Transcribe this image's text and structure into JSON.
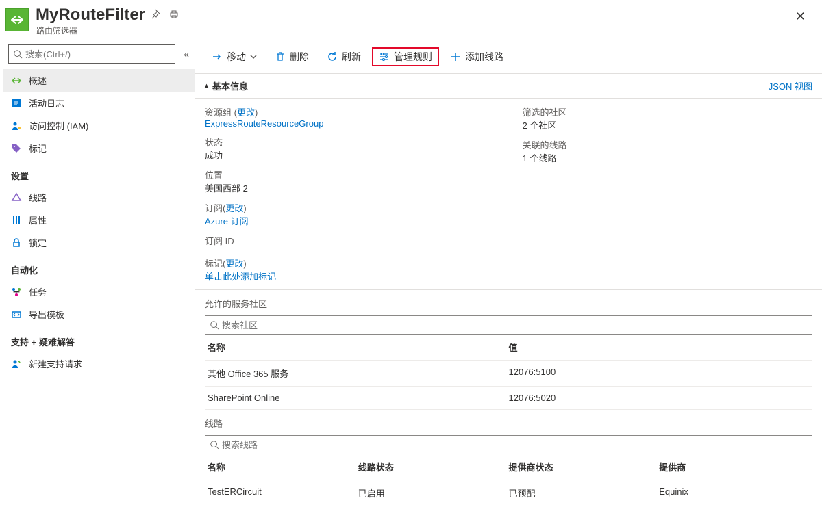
{
  "header": {
    "title": "MyRouteFilter",
    "subtitle": "路由筛选器"
  },
  "search": {
    "placeholder": "搜索(Ctrl+/)"
  },
  "nav": {
    "main": [
      {
        "label": "概述",
        "active": true
      },
      {
        "label": "活动日志"
      },
      {
        "label": "访问控制 (IAM)"
      },
      {
        "label": "标记"
      }
    ],
    "groups": [
      {
        "title": "设置",
        "items": [
          {
            "label": "线路"
          },
          {
            "label": "属性"
          },
          {
            "label": "锁定"
          }
        ]
      },
      {
        "title": "自动化",
        "items": [
          {
            "label": "任务"
          },
          {
            "label": "导出模板"
          }
        ]
      },
      {
        "title": "支持 + 疑难解答",
        "items": [
          {
            "label": "新建支持请求"
          }
        ]
      }
    ]
  },
  "toolbar": {
    "move": "移动",
    "delete": "删除",
    "refresh": "刷新",
    "manage": "管理规则",
    "add": "添加线路"
  },
  "section": {
    "title": "基本信息",
    "json_view": "JSON 视图"
  },
  "props": {
    "left": [
      {
        "label": "资源组",
        "change": "更改",
        "linkval": "ExpressRouteResourceGroup"
      },
      {
        "label": "状态",
        "val": "成功"
      },
      {
        "label": "位置",
        "val": "美国西部 2"
      },
      {
        "label": "订阅",
        "change": "更改",
        "linkval": "Azure 订阅"
      },
      {
        "label": "订阅 ID",
        "val": ""
      }
    ],
    "right": [
      {
        "label": "筛选的社区",
        "val": "2 个社区"
      },
      {
        "label": "关联的线路",
        "val": "1 个线路"
      }
    ],
    "tags": {
      "label": "标记",
      "change": "更改",
      "link": "单击此处添加标记"
    }
  },
  "communities": {
    "title": "允许的服务社区",
    "search": "搜索社区",
    "cols": [
      "名称",
      "值"
    ],
    "rows": [
      {
        "name": "其他 Office 365 服务",
        "val": "12076:5100"
      },
      {
        "name": "SharePoint Online",
        "val": "12076:5020"
      }
    ]
  },
  "circuits": {
    "title": "线路",
    "search": "搜索线路",
    "cols": [
      "名称",
      "线路状态",
      "提供商状态",
      "提供商"
    ],
    "rows": [
      {
        "name": "TestERCircuit",
        "cstatus": "已启用",
        "pstatus": "已预配",
        "provider": "Equinix"
      }
    ]
  }
}
